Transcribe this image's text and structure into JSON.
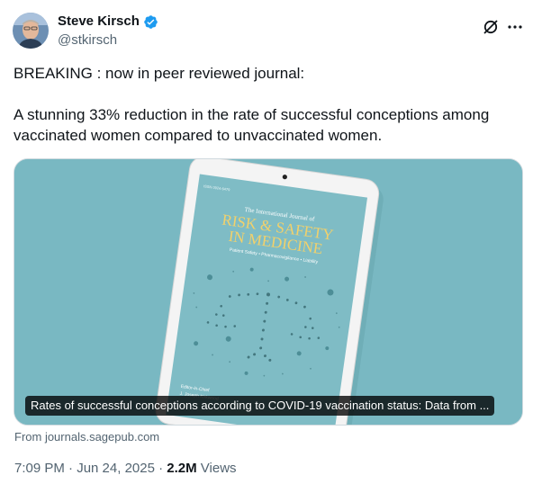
{
  "author": {
    "name": "Steve Kirsch",
    "handle": "@stkirsch",
    "verified_color": "#1d9bf0"
  },
  "post": {
    "line1": "BREAKING : now in peer reviewed journal:",
    "line2": "A stunning 33% reduction in the rate of successful conceptions among vaccinated women compared to unvaccinated women."
  },
  "card": {
    "caption": "Rates of successful conceptions according to COVID-19 vaccination status: Data from ...",
    "source": "From journals.sagepub.com",
    "cover": {
      "kicker": "The International Journal of",
      "title_line1": "RISK & SAFETY",
      "title_line2": "IN MEDICINE",
      "subtitle": "Patient Safety • Pharmacovigilance • Liability",
      "footer": "Editor-in-Chief",
      "editor": "J. Joseph Kirkwood"
    },
    "background_color": "#79b8c2"
  },
  "meta": {
    "time": "7:09 PM · Jun 24, 2025 · ",
    "views_count": "2.2M",
    "views_label": " Views"
  },
  "icons": {
    "verified": "verified-badge-icon",
    "grok": "grok-icon",
    "more": "more-icon"
  }
}
